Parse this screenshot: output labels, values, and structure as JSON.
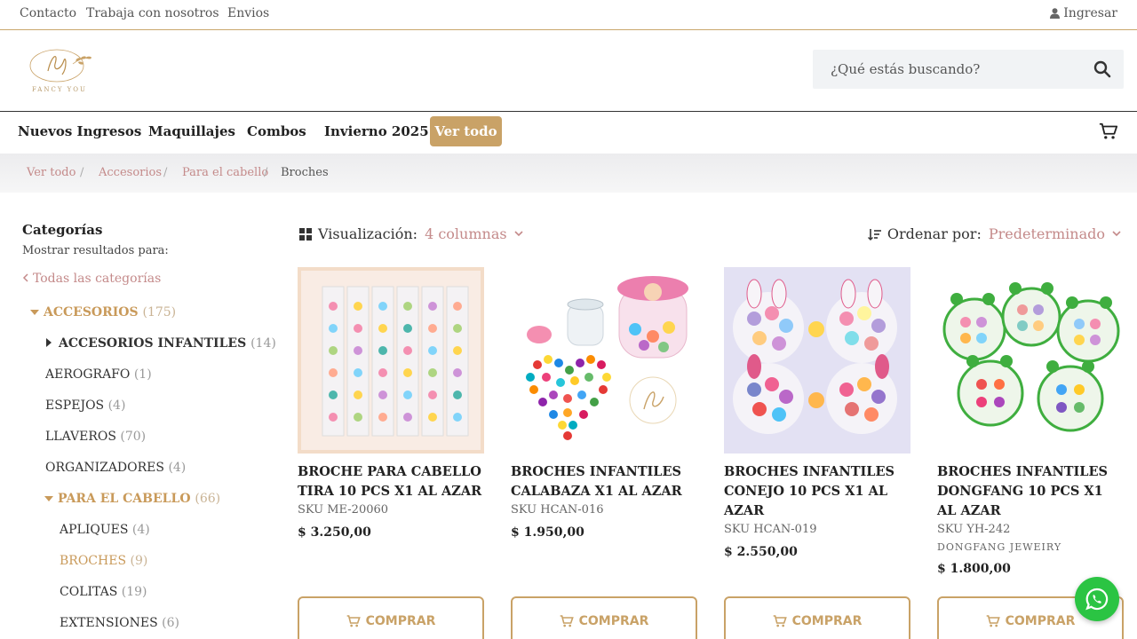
{
  "topbar": {
    "links": [
      "Contacto",
      "Trabaja con nosotros",
      "Envios"
    ],
    "login": "Ingresar"
  },
  "header": {
    "logo_text": "FANCY YOU",
    "search_placeholder": "¿Qué estás buscando?"
  },
  "nav": {
    "items": [
      "Nuevos Ingresos",
      "Maquillajes",
      "Combos",
      "Invierno 2025"
    ],
    "highlight": "Ver todo"
  },
  "breadcrumb": {
    "items": [
      "Ver todo",
      "Accesorios",
      "Para el cabello"
    ],
    "current": "Broches",
    "separator": "/"
  },
  "sidebar": {
    "title": "Categorías",
    "subtitle": "Mostrar resultados para:",
    "all_link": "Todas las categorías",
    "categories": [
      {
        "name": "ACCESORIOS",
        "count": "(175)"
      },
      {
        "name": "ACCESORIOS INFANTILES",
        "count": "(14)"
      },
      {
        "name": "AEROGRAFO",
        "count": "(1)"
      },
      {
        "name": "ESPEJOS",
        "count": "(4)"
      },
      {
        "name": "LLAVEROS",
        "count": "(70)"
      },
      {
        "name": "ORGANIZADORES",
        "count": "(4)"
      },
      {
        "name": "PARA EL CABELLO",
        "count": "(66)"
      },
      {
        "name": "APLIQUES",
        "count": "(4)"
      },
      {
        "name": "BROCHES",
        "count": "(9)"
      },
      {
        "name": "COLITAS",
        "count": "(19)"
      },
      {
        "name": "EXTENSIONES",
        "count": "(6)"
      }
    ]
  },
  "toolbar": {
    "view_label": "Visualización:",
    "view_value": "4 columnas",
    "sort_label": "Ordenar por:",
    "sort_value": "Predeterminado"
  },
  "products": [
    {
      "name": "BROCHE PARA CABELLO TIRA 10 PCS X1 AL AZAR",
      "sku": "SKU ME-20060",
      "brand": "",
      "price": "$  3.250,00",
      "button": "COMPRAR"
    },
    {
      "name": "BROCHES INFANTILES CALABAZA X1 AL AZAR",
      "sku": "SKU HCAN-016",
      "brand": "",
      "price": "$  1.950,00",
      "button": "COMPRAR"
    },
    {
      "name": "BROCHES INFANTILES CONEJO 10 PCS X1 AL AZAR",
      "sku": "SKU HCAN-019",
      "brand": "",
      "price": "$  2.550,00",
      "button": "COMPRAR"
    },
    {
      "name": "BROCHES INFANTILES DONGFANG 10 PCS X1 AL AZAR",
      "sku": "SKU YH-242",
      "brand": "DONGFANG JEWEIRY",
      "price": "$  1.800,00",
      "button": "COMPRAR"
    }
  ],
  "colors": {
    "gold": "#c9a267",
    "rose": "#c48a8a",
    "whatsapp": "#2bc443"
  }
}
